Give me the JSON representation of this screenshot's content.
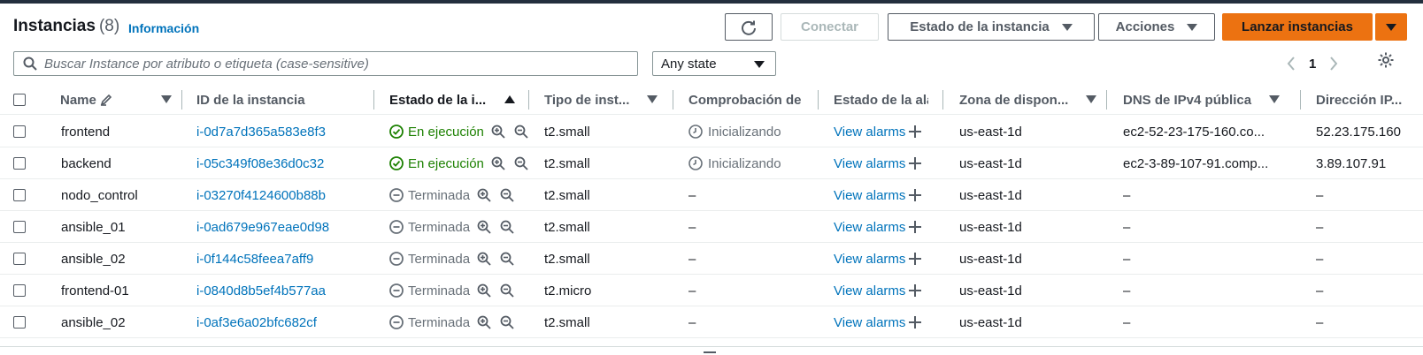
{
  "header": {
    "title": "Instancias",
    "count": "(8)",
    "info_link": "Información"
  },
  "toolbar": {
    "refresh_icon": "refresh-icon",
    "connect_label": "Conectar",
    "instance_state_label": "Estado de la instancia",
    "actions_label": "Acciones",
    "launch_label": "Lanzar instancias"
  },
  "search": {
    "placeholder": "Buscar Instance por atributo o etiqueta (case-sensitive)",
    "value": ""
  },
  "filter": {
    "state_value": "Any state"
  },
  "pagination": {
    "current_page": "1"
  },
  "table": {
    "columns": [
      "Name",
      "ID de la instancia",
      "Estado de la i...",
      "Tipo de inst...",
      "Comprobación de",
      "Estado de la ala",
      "Zona de dispon...",
      "DNS de IPv4 pública",
      "Dirección IP..."
    ],
    "rows": [
      {
        "name": "frontend",
        "id": "i-0d7a7d365a583e8f3",
        "state": "En ejecución",
        "state_kind": "running",
        "type": "t2.small",
        "check": "Inicializando",
        "alarm": "View alarms",
        "zone": "us-east-1d",
        "dns": "ec2-52-23-175-160.co...",
        "ip": "52.23.175.160"
      },
      {
        "name": "backend",
        "id": "i-05c349f08e36d0c32",
        "state": "En ejecución",
        "state_kind": "running",
        "type": "t2.small",
        "check": "Inicializando",
        "alarm": "View alarms",
        "zone": "us-east-1d",
        "dns": "ec2-3-89-107-91.comp...",
        "ip": "3.89.107.91"
      },
      {
        "name": "nodo_control",
        "id": "i-03270f4124600b88b",
        "state": "Terminada",
        "state_kind": "terminated",
        "type": "t2.small",
        "check": "–",
        "alarm": "View alarms",
        "zone": "us-east-1d",
        "dns": "–",
        "ip": "–"
      },
      {
        "name": "ansible_01",
        "id": "i-0ad679e967eae0d98",
        "state": "Terminada",
        "state_kind": "terminated",
        "type": "t2.small",
        "check": "–",
        "alarm": "View alarms",
        "zone": "us-east-1d",
        "dns": "–",
        "ip": "–"
      },
      {
        "name": "ansible_02",
        "id": "i-0f144c58feea7aff9",
        "state": "Terminada",
        "state_kind": "terminated",
        "type": "t2.small",
        "check": "–",
        "alarm": "View alarms",
        "zone": "us-east-1d",
        "dns": "–",
        "ip": "–"
      },
      {
        "name": "frontend-01",
        "id": "i-0840d8b5ef4b577aa",
        "state": "Terminada",
        "state_kind": "terminated",
        "type": "t2.micro",
        "check": "–",
        "alarm": "View alarms",
        "zone": "us-east-1d",
        "dns": "–",
        "ip": "–"
      },
      {
        "name": "ansible_02",
        "id": "i-0af3e6a02bfc682cf",
        "state": "Terminada",
        "state_kind": "terminated",
        "type": "t2.small",
        "check": "–",
        "alarm": "View alarms",
        "zone": "us-east-1d",
        "dns": "–",
        "ip": "–"
      }
    ]
  },
  "colors": {
    "link": "#0073bb",
    "running": "#1d8102",
    "primary_button": "#ec7211",
    "topbar": "#232f3e"
  }
}
